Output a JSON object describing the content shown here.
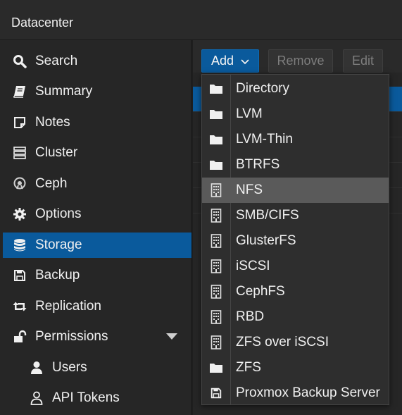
{
  "header": {
    "title": "Datacenter"
  },
  "sidebar": {
    "items": [
      {
        "label": "Search",
        "icon": "search-icon"
      },
      {
        "label": "Summary",
        "icon": "book-icon"
      },
      {
        "label": "Notes",
        "icon": "note-icon"
      },
      {
        "label": "Cluster",
        "icon": "server-icon"
      },
      {
        "label": "Ceph",
        "icon": "ceph-icon"
      },
      {
        "label": "Options",
        "icon": "gear-icon"
      },
      {
        "label": "Storage",
        "icon": "database-icon",
        "active": true
      },
      {
        "label": "Backup",
        "icon": "floppy-icon"
      },
      {
        "label": "Replication",
        "icon": "retweet-icon"
      },
      {
        "label": "Permissions",
        "icon": "unlock-icon",
        "expanded": true
      },
      {
        "label": "Users",
        "icon": "user-icon"
      },
      {
        "label": "API Tokens",
        "icon": "user-outline-icon"
      }
    ]
  },
  "toolbar": {
    "add_label": "Add",
    "remove_label": "Remove",
    "edit_label": "Edit"
  },
  "add_menu": {
    "items": [
      {
        "label": "Directory",
        "icon": "folder-icon"
      },
      {
        "label": "LVM",
        "icon": "folder-icon"
      },
      {
        "label": "LVM-Thin",
        "icon": "folder-icon"
      },
      {
        "label": "BTRFS",
        "icon": "folder-icon"
      },
      {
        "label": "NFS",
        "icon": "building-icon",
        "hovered": true
      },
      {
        "label": "SMB/CIFS",
        "icon": "building-icon"
      },
      {
        "label": "GlusterFS",
        "icon": "building-icon"
      },
      {
        "label": "iSCSI",
        "icon": "building-icon"
      },
      {
        "label": "CephFS",
        "icon": "building-icon"
      },
      {
        "label": "RBD",
        "icon": "building-icon"
      },
      {
        "label": "ZFS over iSCSI",
        "icon": "building-icon"
      },
      {
        "label": "ZFS",
        "icon": "folder-icon"
      },
      {
        "label": "Proxmox Backup Server",
        "icon": "floppy-icon"
      }
    ]
  },
  "colors": {
    "accent": "#0a5a9c",
    "background": "#262626",
    "menu_hover": "#5a5a5a",
    "text": "#f0f0f0",
    "disabled_text": "#7e7e7e"
  }
}
